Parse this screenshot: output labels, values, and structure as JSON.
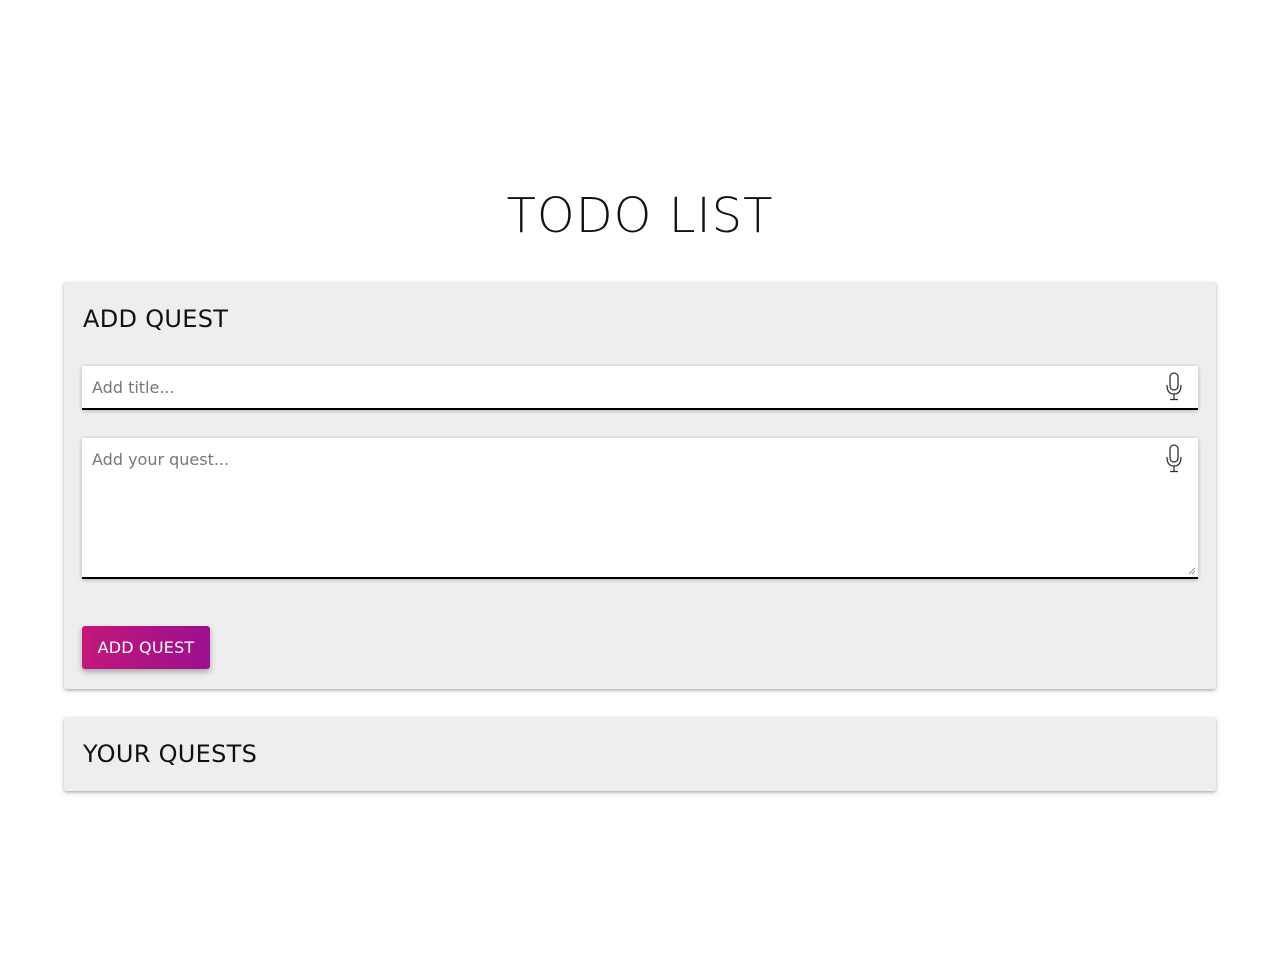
{
  "header": {
    "title": "TODO LIST"
  },
  "add_quest": {
    "heading": "ADD QUEST",
    "title_input": {
      "value": "",
      "placeholder": "Add title..."
    },
    "quest_input": {
      "value": "",
      "placeholder": "Add your quest..."
    },
    "submit_label": "ADD QUEST",
    "mic_icon": "microphone-icon"
  },
  "your_quests": {
    "heading": "YOUR QUESTS",
    "items": []
  },
  "colors": {
    "button_gradient_start": "#c2187a",
    "button_gradient_end": "#9c0f8f",
    "card_background": "#eeeeee"
  }
}
